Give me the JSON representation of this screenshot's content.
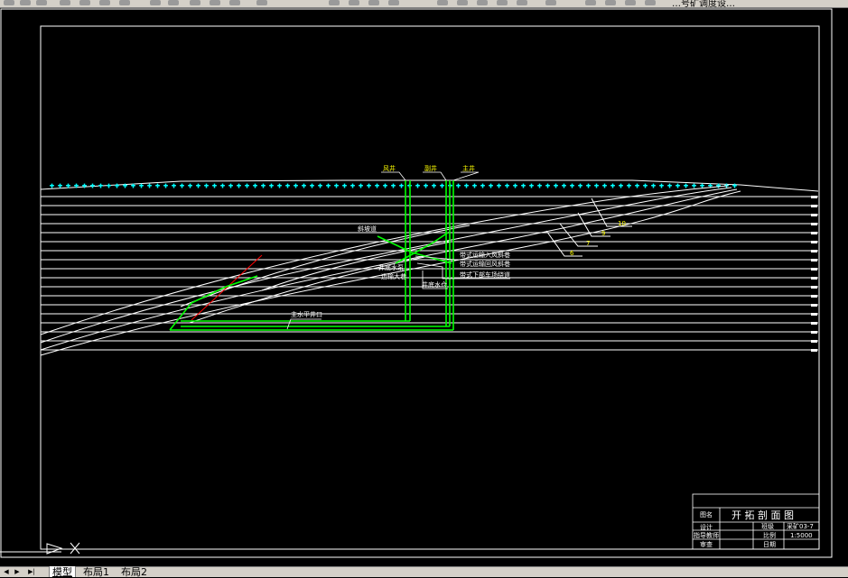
{
  "toolbar": {
    "partial_label": "…号矿调度设…"
  },
  "drawing": {
    "shaft_labels": [
      "风井",
      "副井",
      "主井"
    ],
    "lane_labels": {
      "inclined_lane": "斜坡道",
      "pass_left_1": "井底水泵",
      "pass_left_2": "运输大巷",
      "sump": "井底水仓",
      "note_1": "带式运输入风斜巷",
      "note_2": "带式运输回风斜巷",
      "note_3": "带式下部车场绕道",
      "adit": "主水平井口"
    },
    "seam_labels": [
      "10",
      "9",
      "7",
      "6"
    ],
    "seam_colors": {
      "seam": "#ffffff",
      "mine": "#00ff00",
      "fault": "#ff0000",
      "label": "#ffff00",
      "surface": "#00ffff"
    }
  },
  "title_block": {
    "title_key": "图名",
    "title": "开 拓 剖 面 图",
    "designer_key": "设计",
    "class_key": "班级",
    "class_value": "采矿03-7",
    "advisor_key": "指导教师",
    "scale_key": "比例",
    "scale_value": "1:5000",
    "reviewer_key": "审查",
    "date_key": "日期"
  },
  "tabs": {
    "model": "模型",
    "layout1": "布局1",
    "layout2": "布局2"
  },
  "nav": {
    "first": "◀",
    "prev": "▶",
    "next": "▶|"
  }
}
